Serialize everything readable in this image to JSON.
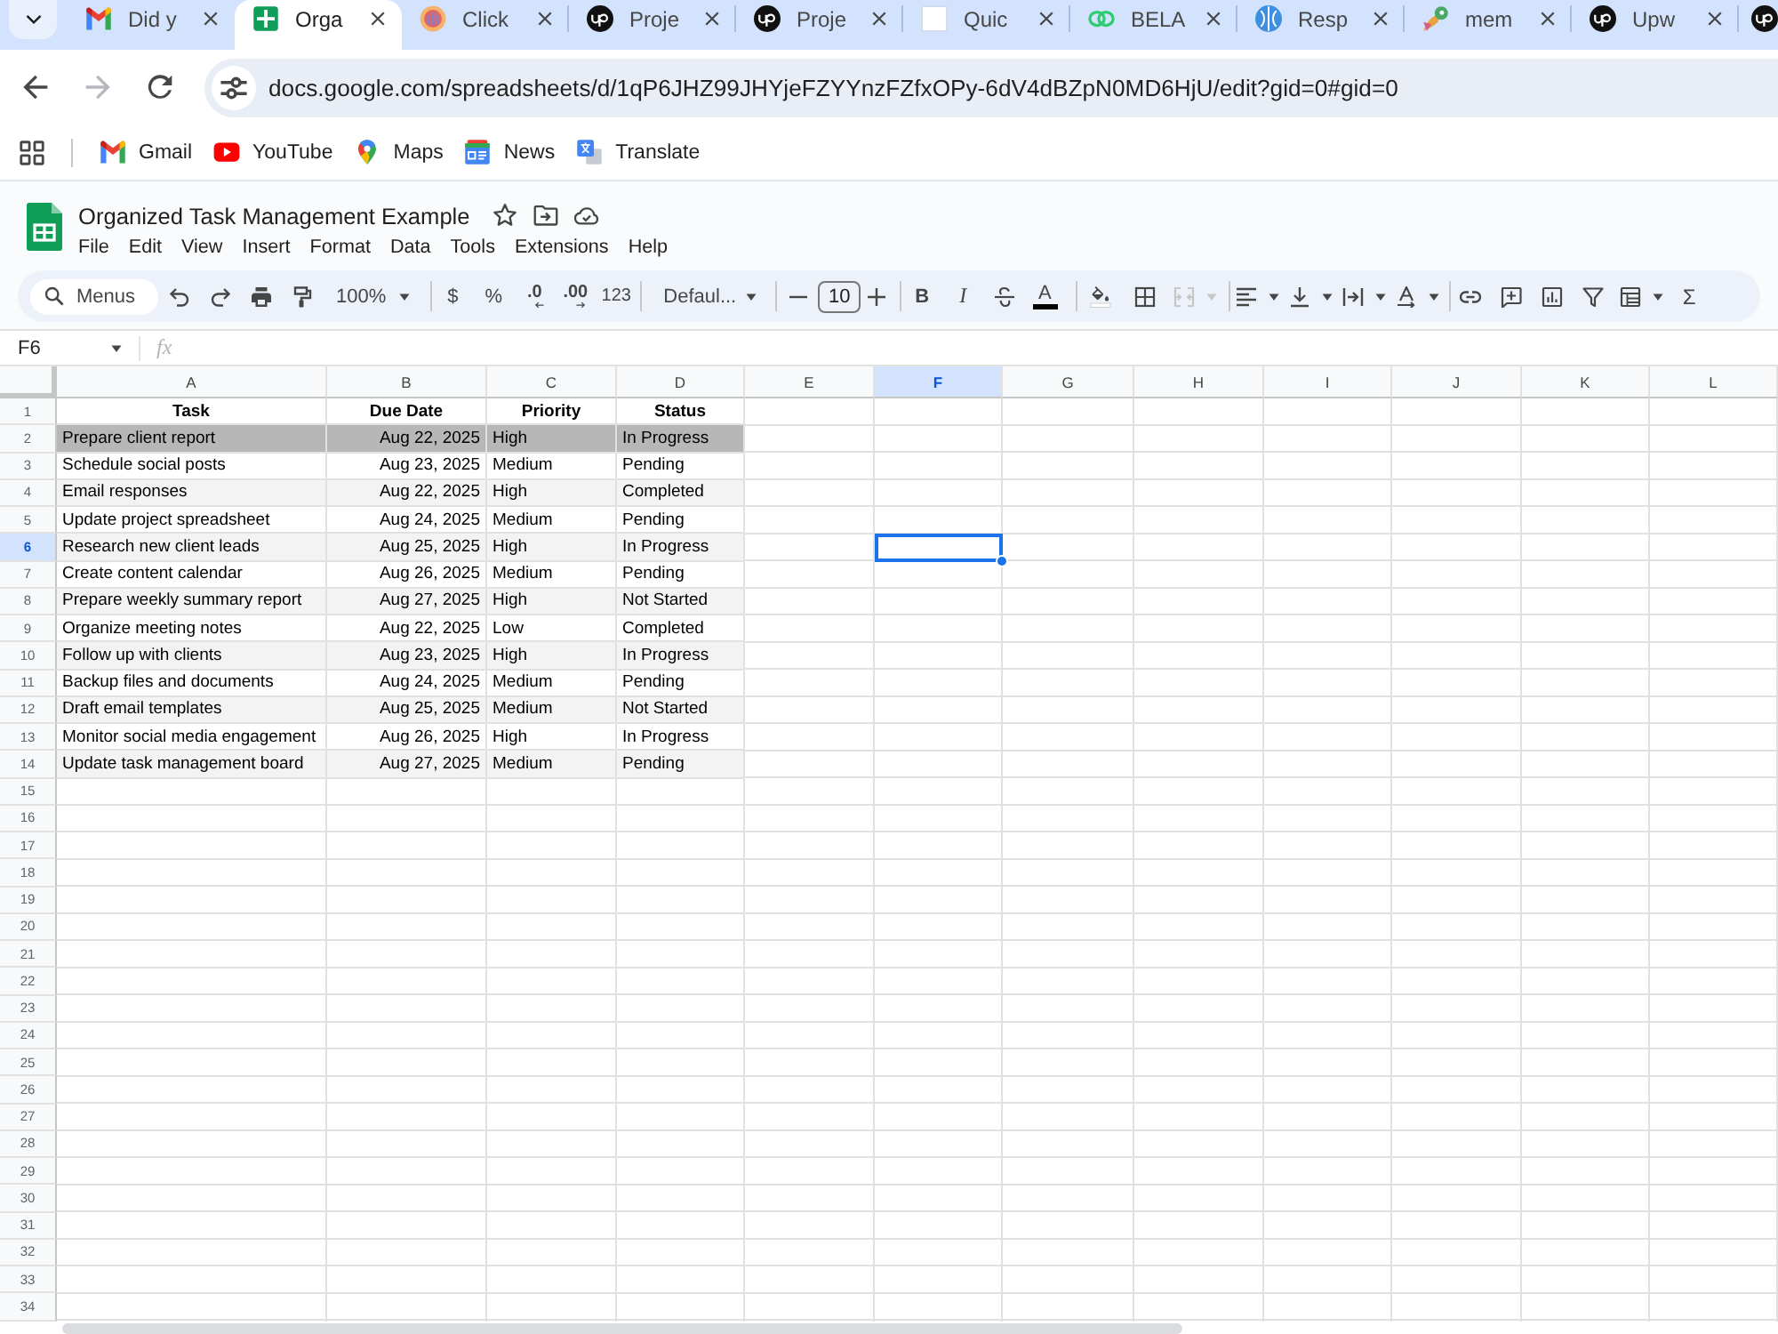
{
  "browser": {
    "tabs": [
      {
        "title": "Did y",
        "kind": "mail",
        "selected": false
      },
      {
        "title": "Orga",
        "kind": "sheet",
        "selected": true
      },
      {
        "title": "Click",
        "kind": "orb",
        "selected": false
      },
      {
        "title": "Proje",
        "kind": "up",
        "selected": false
      },
      {
        "title": "Proje",
        "kind": "up",
        "selected": false
      },
      {
        "title": "Quic",
        "kind": "blank",
        "selected": false
      },
      {
        "title": "BELA",
        "kind": "rings",
        "selected": false
      },
      {
        "title": "Resp",
        "kind": "petal",
        "selected": false
      },
      {
        "title": "mem",
        "kind": "bird",
        "selected": false
      },
      {
        "title": "Upw",
        "kind": "up",
        "selected": false
      },
      {
        "kind": "up",
        "selected": false
      }
    ],
    "forward": {
      "disabled": true
    },
    "url": "docs.google.com/spreadsheets/d/1qP6JHZ99JHYjeFZYYnzFZfxOPy-6dV4dBZpN0MD6HjU/edit?gid=0#gid=0",
    "bookmarks": [
      {
        "label": "Gmail",
        "kind": "mail"
      },
      {
        "label": "YouTube",
        "kind": "video"
      },
      {
        "label": "Maps",
        "kind": "pin"
      },
      {
        "label": "News",
        "kind": "news"
      },
      {
        "label": "Translate",
        "kind": "translate"
      }
    ]
  },
  "document": {
    "title": "Organized Task Management Example",
    "menu": [
      "File",
      "Edit",
      "View",
      "Insert",
      "Format",
      "Data",
      "Tools",
      "Extensions",
      "Help"
    ]
  },
  "toolbar": {
    "search_placeholder": "Menus",
    "zoom": "100%",
    "currency": "$",
    "percent": "%",
    "decrease_decimals": ".0",
    "increase_decimals": ".00",
    "number_format": "123",
    "font": "Defaul...",
    "font_size": "10",
    "bold": "B",
    "italic": "I",
    "text_color": "A",
    "merge_cells": {
      "disabled": true
    },
    "functions": "Σ"
  },
  "formula_bar": {
    "name_box": "F6",
    "function_label": "fx"
  },
  "grid": {
    "columns": [
      {
        "label": "A",
        "selected": false
      },
      {
        "label": "B",
        "selected": false
      },
      {
        "label": "C",
        "selected": false
      },
      {
        "label": "D",
        "selected": false
      },
      {
        "label": "E",
        "selected": false
      },
      {
        "label": "F",
        "selected": true
      },
      {
        "label": "G",
        "selected": false
      },
      {
        "label": "H",
        "selected": false
      },
      {
        "label": "I",
        "selected": false
      },
      {
        "label": "J",
        "selected": false
      },
      {
        "label": "K",
        "selected": false
      },
      {
        "label": "L",
        "selected": false
      }
    ],
    "rows": [
      {
        "number": "1",
        "selected": false,
        "highlighted": false,
        "kind": "header",
        "cells": [
          "Task",
          "Due Date",
          "Priority",
          "Status"
        ]
      },
      {
        "number": "2",
        "selected": false,
        "highlighted": true,
        "kind": "data",
        "cells": [
          "Prepare client report",
          "Aug 22, 2025",
          "High",
          "In Progress"
        ]
      },
      {
        "number": "3",
        "selected": false,
        "highlighted": false,
        "kind": "data",
        "cells": [
          "Schedule social posts",
          "Aug 23, 2025",
          "Medium",
          "Pending"
        ]
      },
      {
        "number": "4",
        "selected": false,
        "highlighted": false,
        "kind": "data",
        "cells": [
          "Email responses",
          "Aug 22, 2025",
          "High",
          "Completed"
        ]
      },
      {
        "number": "5",
        "selected": false,
        "highlighted": false,
        "kind": "data",
        "cells": [
          "Update project spreadsheet",
          "Aug 24, 2025",
          "Medium",
          "Pending"
        ]
      },
      {
        "number": "6",
        "selected": true,
        "highlighted": false,
        "kind": "data",
        "cells": [
          "Research new client leads",
          "Aug 25, 2025",
          "High",
          "In Progress"
        ]
      },
      {
        "number": "7",
        "selected": false,
        "highlighted": false,
        "kind": "data",
        "cells": [
          "Create content calendar",
          "Aug 26, 2025",
          "Medium",
          "Pending"
        ]
      },
      {
        "number": "8",
        "selected": false,
        "highlighted": false,
        "kind": "data",
        "cells": [
          "Prepare weekly summary report",
          "Aug 27, 2025",
          "High",
          "Not Started"
        ]
      },
      {
        "number": "9",
        "selected": false,
        "highlighted": false,
        "kind": "data",
        "cells": [
          "Organize meeting notes",
          "Aug 22, 2025",
          "Low",
          "Completed"
        ]
      },
      {
        "number": "10",
        "selected": false,
        "highlighted": false,
        "kind": "data",
        "cells": [
          "Follow up with clients",
          "Aug 23, 2025",
          "High",
          "In Progress"
        ]
      },
      {
        "number": "11",
        "selected": false,
        "highlighted": false,
        "kind": "data",
        "cells": [
          "Backup files and documents",
          "Aug 24, 2025",
          "Medium",
          "Pending"
        ]
      },
      {
        "number": "12",
        "selected": false,
        "highlighted": false,
        "kind": "data",
        "cells": [
          "Draft email templates",
          "Aug 25, 2025",
          "Medium",
          "Not Started"
        ]
      },
      {
        "number": "13",
        "selected": false,
        "highlighted": false,
        "kind": "data",
        "cells": [
          "Monitor social media engagement",
          "Aug 26, 2025",
          "High",
          "In Progress"
        ]
      },
      {
        "number": "14",
        "selected": false,
        "highlighted": false,
        "kind": "data",
        "cells": [
          "Update task management board",
          "Aug 27, 2025",
          "Medium",
          "Pending"
        ]
      },
      {
        "number": "15",
        "selected": false,
        "highlighted": false,
        "kind": "empty"
      },
      {
        "number": "16",
        "selected": false,
        "highlighted": false,
        "kind": "empty"
      },
      {
        "number": "17",
        "selected": false,
        "highlighted": false,
        "kind": "empty"
      },
      {
        "number": "18",
        "selected": false,
        "highlighted": false,
        "kind": "empty"
      },
      {
        "number": "19",
        "selected": false,
        "highlighted": false,
        "kind": "empty"
      },
      {
        "number": "20",
        "selected": false,
        "highlighted": false,
        "kind": "empty"
      },
      {
        "number": "21",
        "selected": false,
        "highlighted": false,
        "kind": "empty"
      },
      {
        "number": "22",
        "selected": false,
        "highlighted": false,
        "kind": "empty"
      },
      {
        "number": "23",
        "selected": false,
        "highlighted": false,
        "kind": "empty"
      },
      {
        "number": "24",
        "selected": false,
        "highlighted": false,
        "kind": "empty"
      },
      {
        "number": "25",
        "selected": false,
        "highlighted": false,
        "kind": "empty"
      },
      {
        "number": "26",
        "selected": false,
        "highlighted": false,
        "kind": "empty"
      },
      {
        "number": "27",
        "selected": false,
        "highlighted": false,
        "kind": "empty"
      },
      {
        "number": "28",
        "selected": false,
        "highlighted": false,
        "kind": "empty"
      },
      {
        "number": "29",
        "selected": false,
        "highlighted": false,
        "kind": "empty"
      },
      {
        "number": "30",
        "selected": false,
        "highlighted": false,
        "kind": "empty"
      },
      {
        "number": "31",
        "selected": false,
        "highlighted": false,
        "kind": "empty"
      },
      {
        "number": "32",
        "selected": false,
        "highlighted": false,
        "kind": "empty"
      },
      {
        "number": "33",
        "selected": false,
        "highlighted": false,
        "kind": "empty"
      },
      {
        "number": "34",
        "selected": false,
        "highlighted": false,
        "kind": "empty"
      }
    ]
  }
}
